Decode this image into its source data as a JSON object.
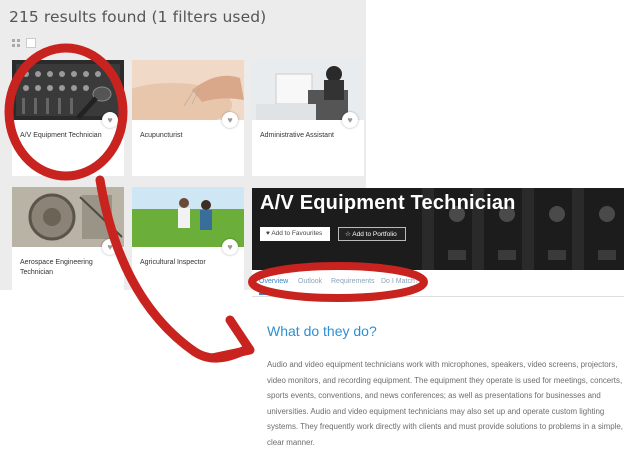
{
  "results": {
    "count_text": "215 results found (1 filters used)"
  },
  "cards": [
    {
      "title": "A/V Equipment Technician",
      "icon": "heart-icon"
    },
    {
      "title": "Acupuncturist",
      "icon": "heart-icon"
    },
    {
      "title": "Administrative Assistant",
      "icon": "heart-icon"
    },
    {
      "title": "Aerospace Engineering Technician",
      "icon": "heart-icon"
    },
    {
      "title": "Agricultural Inspector",
      "icon": "heart-icon"
    }
  ],
  "detail": {
    "title": "A/V Equipment Technician",
    "add_favourites": "Add to Favourites",
    "add_portfolio": "Add to Portfolio",
    "tabs": [
      "Overview",
      "Outlook",
      "Requirements",
      "Do I Match?"
    ],
    "active_tab": "Overview",
    "section_title": "What do they do?",
    "description": "Audio and video equipment technicians work with microphones, speakers, video screens, projectors, video monitors, and recording equipment. The equipment they operate is used for meetings, concerts, sports events, conventions, and news conferences; as well as presentations for businesses and universities. Audio and video equipment technicians may also set up and operate custom lighting systems. They frequently work directly with clients and must provide solutions to problems in a simple, clear manner."
  },
  "colors": {
    "annotation": "#c8231e",
    "accent": "#2e8fd0"
  }
}
